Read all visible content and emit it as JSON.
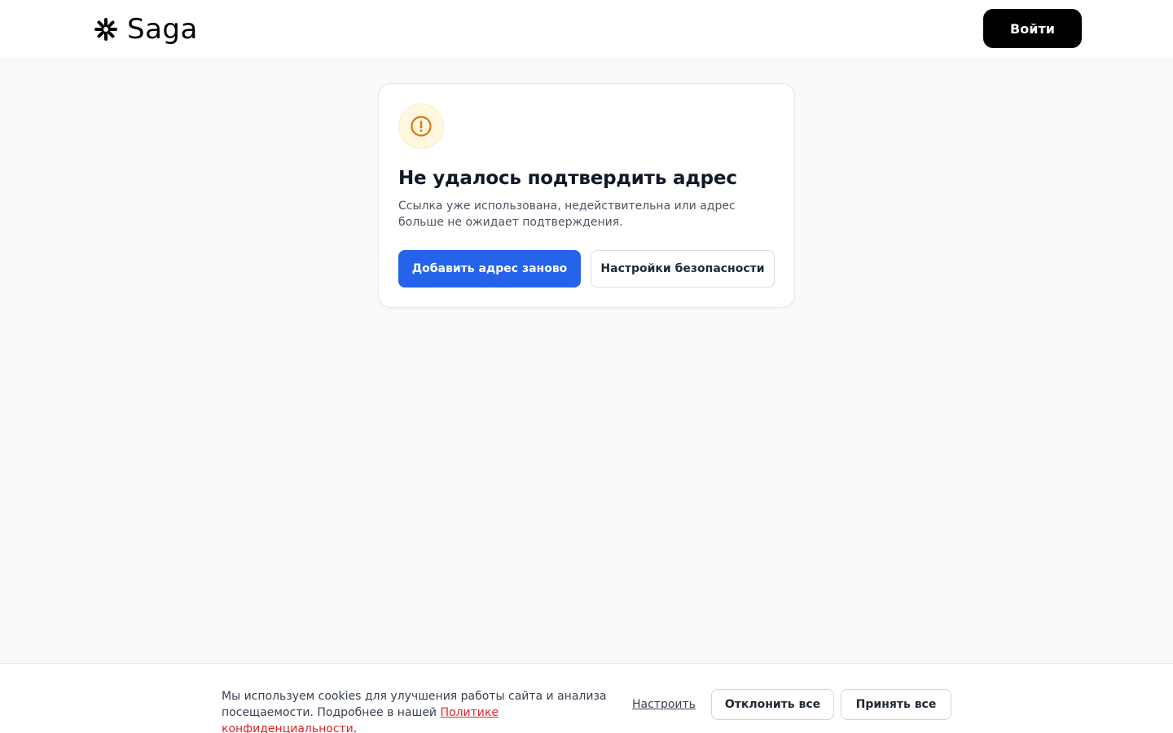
{
  "header": {
    "logo_text": "Saga",
    "logo_icon": "asterisk-logo-icon",
    "login_label": "Войти"
  },
  "card": {
    "icon": "warning-circle-icon",
    "title": "Не удалось подтвердить адрес",
    "description": "Ссылка уже использована, недействительна или адрес больше не ожидает подтверждения.",
    "primary_label": "Добавить адрес заново",
    "secondary_label": "Настройки безопасности"
  },
  "cookie": {
    "text_before": "Мы используем cookies для улучшения работы сайта и анализа посещаемости. Подробнее в нашей ",
    "policy_link": "Политике конфиденциальности",
    "text_after": ".",
    "customize_label": "Настроить",
    "reject_label": "Отклонить все",
    "accept_label": "Принять все"
  },
  "colors": {
    "primary": "#2563eb",
    "warning": "#d97706",
    "warning_bg": "#fff7e0",
    "link": "#dc2626",
    "page_bg": "#f8f9fb"
  }
}
